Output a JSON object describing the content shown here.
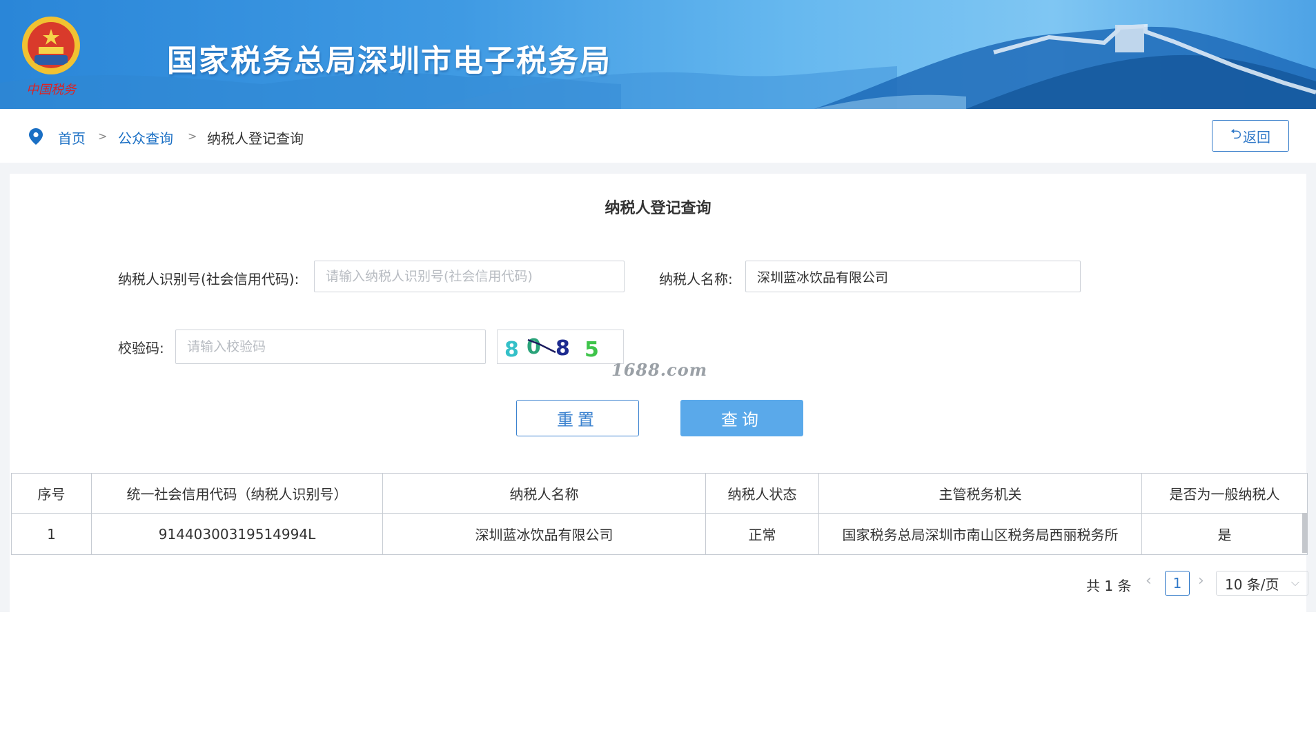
{
  "header": {
    "title": "国家税务总局深圳市电子税务局",
    "emblem_text": "中国税务"
  },
  "breadcrumb": {
    "items": [
      {
        "label": "首页"
      },
      {
        "label": "公众查询"
      },
      {
        "label": "纳税人登记查询"
      }
    ],
    "separator": ">"
  },
  "back_button": {
    "label": "返回",
    "icon": "return-icon"
  },
  "page_title": "纳税人登记查询",
  "form": {
    "taxpayer_id": {
      "label": "纳税人识别号(社会信用代码):",
      "placeholder": "请输入纳税人识别号(社会信用代码)",
      "value": ""
    },
    "taxpayer_name": {
      "label": "纳税人名称:",
      "placeholder": "",
      "value": "深圳蓝冰饮品有限公司"
    },
    "captcha": {
      "label": "校验码:",
      "placeholder": "请输入校验码",
      "value": "",
      "image_text": "8085"
    },
    "reset_label": "重置",
    "query_label": "查询"
  },
  "watermark": "1688.com",
  "table": {
    "headers": [
      "序号",
      "统一社会信用代码（纳税人识别号）",
      "纳税人名称",
      "纳税人状态",
      "主管税务机关",
      "是否为一般纳税人"
    ],
    "rows": [
      [
        "1",
        "91440300319514994L",
        "深圳蓝冰饮品有限公司",
        "正常",
        "国家税务总局深圳市南山区税务局西丽税务所",
        "是"
      ]
    ]
  },
  "pagination": {
    "total_text": "共 1 条",
    "current_page": "1",
    "page_size": "10 条/页"
  },
  "colors": {
    "primary": "#2f78c8",
    "query_button": "#5aa9ea",
    "banner": "#3f9ae3"
  }
}
